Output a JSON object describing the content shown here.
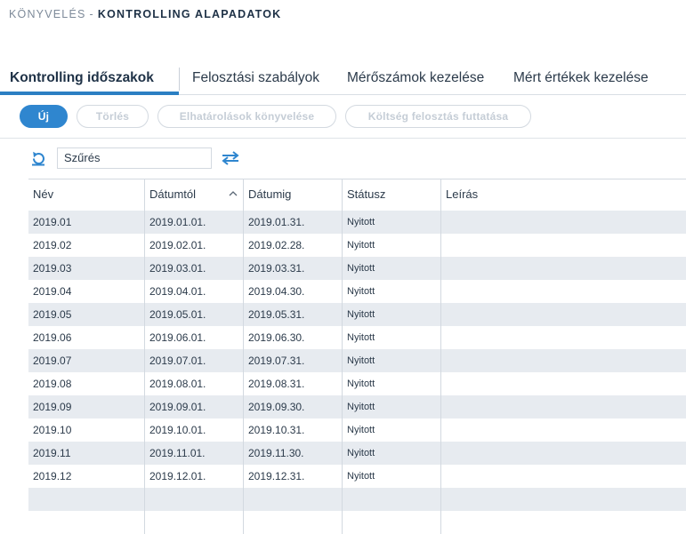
{
  "breadcrumb": {
    "parent": "KÖNYVELÉS",
    "separator": "-",
    "current": "KONTROLLING ALAPADATOK"
  },
  "tabs": [
    {
      "label": "Kontrolling időszakok",
      "active": true
    },
    {
      "label": "Felosztási szabályok",
      "active": false
    },
    {
      "label": "Mérőszámok kezelése",
      "active": false
    },
    {
      "label": "Mért értékek kezelése",
      "active": false
    }
  ],
  "toolbar": {
    "new_label": "Új",
    "delete_label": "Törlés",
    "accruals_label": "Elhatárolások könyvelése",
    "cost_allocation_label": "Költség felosztás futtatása"
  },
  "filter": {
    "value": "Szűrés"
  },
  "table": {
    "columns": [
      "Név",
      "Dátumtól",
      "Dátumig",
      "Státusz",
      "Leírás"
    ],
    "sorted_column": "Dátumtól",
    "sort_direction": "ascending",
    "rows": [
      [
        "2019.01",
        "2019.01.01.",
        "2019.01.31.",
        "Nyitott",
        ""
      ],
      [
        "2019.02",
        "2019.02.01.",
        "2019.02.28.",
        "Nyitott",
        ""
      ],
      [
        "2019.03",
        "2019.03.01.",
        "2019.03.31.",
        "Nyitott",
        ""
      ],
      [
        "2019.04",
        "2019.04.01.",
        "2019.04.30.",
        "Nyitott",
        ""
      ],
      [
        "2019.05",
        "2019.05.01.",
        "2019.05.31.",
        "Nyitott",
        ""
      ],
      [
        "2019.06",
        "2019.06.01.",
        "2019.06.30.",
        "Nyitott",
        ""
      ],
      [
        "2019.07",
        "2019.07.01.",
        "2019.07.31.",
        "Nyitott",
        ""
      ],
      [
        "2019.08",
        "2019.08.01.",
        "2019.08.31.",
        "Nyitott",
        ""
      ],
      [
        "2019.09",
        "2019.09.01.",
        "2019.09.30.",
        "Nyitott",
        ""
      ],
      [
        "2019.10",
        "2019.10.01.",
        "2019.10.31.",
        "Nyitott",
        ""
      ],
      [
        "2019.11",
        "2019.11.01.",
        "2019.11.30.",
        "Nyitott",
        ""
      ],
      [
        "2019.12",
        "2019.12.01.",
        "2019.12.31.",
        "Nyitott",
        ""
      ],
      [
        "",
        "",
        "",
        "",
        ""
      ],
      [
        "",
        "",
        "",
        "",
        ""
      ]
    ]
  },
  "icons": {
    "refresh": "refresh-icon",
    "swap": "swap-arrows-icon",
    "sort": "sort-ascending-icon"
  },
  "colors": {
    "accent": "#2f86cf",
    "row_stripe": "#e7ebf0",
    "disabled_text": "#c5cdd6"
  }
}
